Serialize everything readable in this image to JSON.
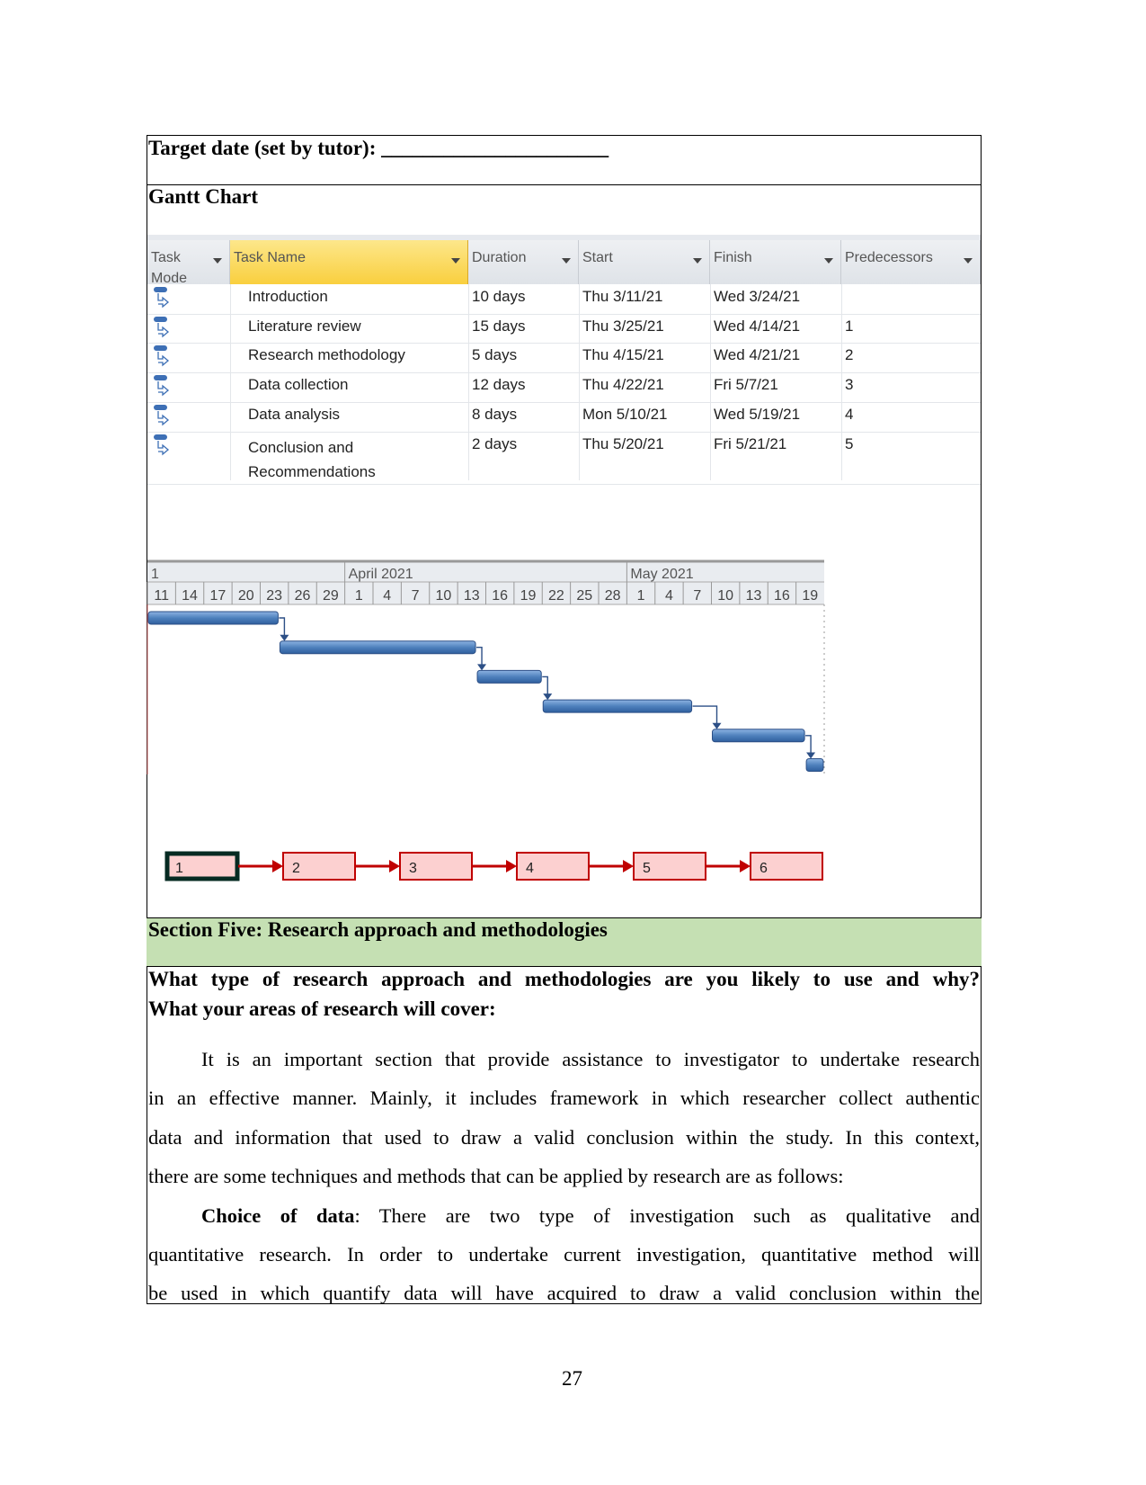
{
  "target_date_label": "Target date (set by tutor): ______________________",
  "gantt_heading": "Gantt Chart",
  "table": {
    "columns": [
      "Task Mode",
      "Task Name",
      "Duration",
      "Start",
      "Finish",
      "Predecessors"
    ],
    "rows": [
      {
        "name": "Introduction",
        "duration": "10 days",
        "start": "Thu 3/11/21",
        "finish": "Wed 3/24/21",
        "pred": ""
      },
      {
        "name": "Literature review",
        "duration": "15 days",
        "start": "Thu 3/25/21",
        "finish": "Wed 4/14/21",
        "pred": "1"
      },
      {
        "name": "Research methodology",
        "duration": "5 days",
        "start": "Thu 4/15/21",
        "finish": "Wed 4/21/21",
        "pred": "2"
      },
      {
        "name": "Data collection",
        "duration": "12 days",
        "start": "Thu 4/22/21",
        "finish": "Fri 5/7/21",
        "pred": "3"
      },
      {
        "name": "Data analysis",
        "duration": "8 days",
        "start": "Mon 5/10/21",
        "finish": "Wed 5/19/21",
        "pred": "4"
      },
      {
        "name": "Conclusion and Recommendations",
        "name_lines": [
          "Conclusion and",
          "Recommendations"
        ],
        "duration": "2 days",
        "start": "Thu 5/20/21",
        "finish": "Fri 5/21/21",
        "pred": "5"
      }
    ]
  },
  "chart_data": {
    "type": "gantt",
    "months": [
      {
        "label": "1",
        "start": "2021-03-11"
      },
      {
        "label": "April 2021",
        "start": "2021-04-01"
      },
      {
        "label": "May 2021",
        "start": "2021-05-01"
      }
    ],
    "day_ticks": [
      "11",
      "14",
      "17",
      "20",
      "23",
      "26",
      "29",
      "1",
      "4",
      "7",
      "10",
      "13",
      "16",
      "19",
      "22",
      "25",
      "28",
      "1",
      "4",
      "7",
      "10",
      "13",
      "16",
      "19"
    ],
    "range": [
      "2021-03-11",
      "2021-05-21"
    ],
    "tasks": [
      {
        "id": 1,
        "start": "2021-03-11",
        "end": "2021-03-24"
      },
      {
        "id": 2,
        "start": "2021-03-25",
        "end": "2021-04-14"
      },
      {
        "id": 3,
        "start": "2021-04-15",
        "end": "2021-04-21"
      },
      {
        "id": 4,
        "start": "2021-04-22",
        "end": "2021-05-07"
      },
      {
        "id": 5,
        "start": "2021-05-10",
        "end": "2021-05-19"
      },
      {
        "id": 6,
        "start": "2021-05-20",
        "end": "2021-05-21"
      }
    ],
    "bar_color": "#4f81bd",
    "network_nodes": [
      "1",
      "2",
      "3",
      "4",
      "5",
      "6"
    ],
    "network_color": "#c00000"
  },
  "section_heading": "Section Five: Research approach and methodologies",
  "section_color": "#c5e0b3",
  "question_lines": [
    "What type of research approach and methodologies are you likely to use and why?",
    "What your areas of research will cover:"
  ],
  "para1": [
    "It is an important section that provide assistance to investigator to undertake research",
    "in an effective manner. Mainly, it includes framework in which researcher collect authentic",
    "data and information that used to draw a valid conclusion within the study. In this context,",
    "there are some techniques and methods that can be applied by research are as follows:"
  ],
  "para2": {
    "bold": "Choice of data",
    "first_rest": ": There are two type of investigation such as qualitative and",
    "lines": [
      "quantitative research. In order to undertake current investigation, quantitative method will",
      "be used in which quantify data will have acquired to draw a valid conclusion within the"
    ]
  },
  "page_number": "27"
}
